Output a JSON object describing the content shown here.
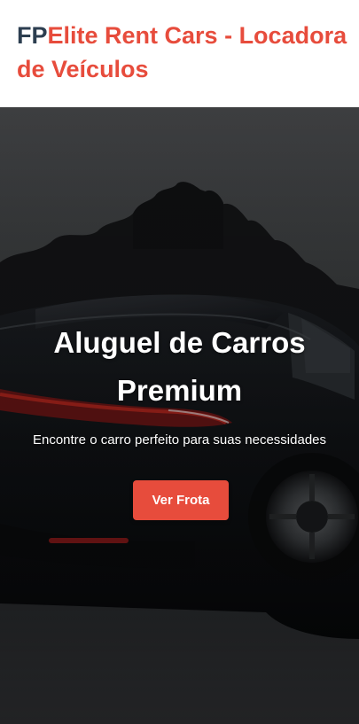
{
  "header": {
    "brand_mark": "FP",
    "brand_name": "Elite Rent Cars - Locadora de Veículos"
  },
  "hero": {
    "title": "Aluguel de Carros Premium",
    "subtitle": "Encontre o carro perfeito para suas necessidades",
    "cta_label": "Ver Frota",
    "background_image": "black-sports-car-photo"
  },
  "colors": {
    "brand_dark": "#2c3e50",
    "accent": "#e74c3c",
    "hero_text": "#ffffff"
  }
}
